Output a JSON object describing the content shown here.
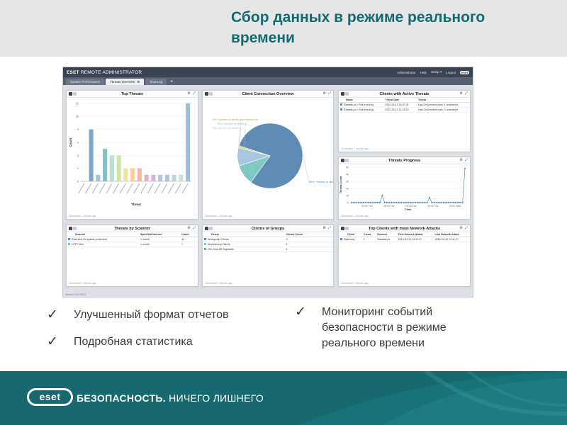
{
  "slide": {
    "title": "Сбор данных в режиме реального времени",
    "bullets_left": [
      "Улучшенный формат отчетов",
      "Подробная  статистика"
    ],
    "bullet_right": "Мониторинг событий безопасности в режиме реального времени",
    "check_glyph": "✓",
    "footer": {
      "logo_text": "eset",
      "slogan_bold": "БЕЗОПАСНОСТЬ.",
      "slogan_rest": " НИЧЕГО ЛИШНЕГО"
    },
    "colors": {
      "teal": "#15696f",
      "title": "#16696f",
      "band": "#e6e6e6"
    }
  },
  "era": {
    "brand_prefix": "ESET",
    "brand_suffix": " REMOTE ADMINISTRATOR",
    "top_links": [
      "Administrator",
      "Help",
      "Setup ▾",
      "Logout"
    ],
    "tabs": [
      {
        "label": "System Performance",
        "active": false
      },
      {
        "label": "Threats Overview",
        "active": true
      },
      {
        "label": "ScanLog",
        "active": false
      }
    ],
    "tab_add": "+",
    "version": "Version: 5.0.250.0"
  },
  "widgets": {
    "top_threats": {
      "title": "Top Threats",
      "footer": "Generated 1 minute ago",
      "chart_data": {
        "type": "bar",
        "xlabel": "Threat",
        "ylabel": "Count",
        "ylim": [
          0,
          12
        ],
        "yticks": [
          0,
          2,
          4,
          6,
          8,
          10,
          12
        ],
        "values": [
          0,
          8,
          1,
          5,
          4,
          4,
          2,
          2,
          2,
          1,
          1,
          1,
          1,
          1,
          1,
          12
        ],
        "colors": [
          "#5a8fb4",
          "#7fa6c6",
          "#9fc6dd",
          "#7cc3c2",
          "#b7e0cf",
          "#d0e3a6",
          "#ece59f",
          "#f6cf9b",
          "#f4b6a3",
          "#e9adc4",
          "#cfb7d9",
          "#b6c3e2",
          "#a9c6dc",
          "#b8d8dc",
          "#c9e4d6",
          "#9bbfd6"
        ]
      }
    },
    "client_connection": {
      "title": "Client Connection Overview",
      "footer": "Generated 1 minute ago",
      "chart_data": {
        "type": "pie",
        "slices": [
          {
            "label": "80% / Number of clien...",
            "value": 80,
            "color": "#5d8db5"
          },
          {
            "label": "10% / Number of clients di...",
            "value": 10,
            "color": "#7fc9c4"
          },
          {
            "label": "9% / Number of clients di...",
            "value": 9,
            "color": "#a9c6df"
          },
          {
            "label": "1% / Number of clients disconnected for...",
            "value": 1,
            "color": "#d8d27a"
          }
        ]
      }
    },
    "clients_active_threats": {
      "title": "Clients with Active Threats",
      "footer": "Generated 1 minute ago",
      "columns": [
        "Name",
        "Threat Date",
        "Threat"
      ],
      "rows": [
        [
          "Rakatak-pc / Rak-eea-eng",
          "2012-04-13 16:47:41",
          "Last OnDemand scan: 1 uncleaned"
        ],
        [
          "Rakatak-pc / Rak-eea-eng",
          "2012-04-13 11:18:29",
          "Last OnDemand scan: 2 uncleaned"
        ]
      ]
    },
    "threats_progress": {
      "title": "Threats Progress",
      "footer": "Generated 1 minute ago",
      "chart_data": {
        "type": "line",
        "xlabel": "Time",
        "ylabel": "Threats Count",
        "ylim": [
          0,
          50
        ],
        "yticks": [
          0,
          10,
          20,
          30,
          40,
          50
        ],
        "xtick_labels": [
          "00:00 Thu",
          "06:00 Tue",
          "00:00 Tue",
          "00:00 Tue",
          "00:00 Wed"
        ],
        "values": [
          0,
          0,
          0,
          0,
          0,
          0,
          0,
          0,
          0,
          0,
          0,
          0,
          0,
          10,
          0,
          0,
          0,
          0,
          0,
          0,
          0,
          0,
          0,
          0,
          0,
          0,
          0,
          0,
          0,
          0,
          0,
          0,
          0,
          7,
          0,
          0,
          0,
          0,
          0,
          0,
          0,
          0,
          0,
          0,
          0,
          0,
          0,
          0,
          48
        ]
      }
    },
    "threats_by_scanner": {
      "title": "Threats by Scanner",
      "footer": "Generated 1 minute ago",
      "columns": [
        "Scanner",
        "Specified Interval",
        "Count"
      ],
      "rows": [
        {
          "color": "#5d8db5",
          "cells": [
            "Real-time file system protection",
            "1 month",
            "41"
          ]
        },
        {
          "color": "#7fc9c4",
          "cells": [
            "HTTP filter",
            "1 month",
            "7"
          ]
        }
      ]
    },
    "clients_of_groups": {
      "title": "Clients of Groups",
      "footer": "Generated 1 minute ago",
      "columns": [
        "Group",
        "Clients Count"
      ],
      "rows": [
        {
          "color": "#5d8db5",
          "cells": [
            "Workgroup Clients",
            "3"
          ]
        },
        {
          "color": "#7fc9c4",
          "cells": [
            "AnyWarning Clients",
            "1"
          ]
        },
        {
          "color": "#6bb36b",
          "cells": [
            "Old Virus DB Signature",
            "1"
          ]
        }
      ]
    },
    "top_clients_attacks": {
      "title": "Top Clients with most Network Attacks",
      "footer": "Generated 1 minute ago",
      "columns": [
        "Client",
        "Count",
        "Scanner",
        "First Network Attack",
        "Last Network Attack"
      ],
      "rows": [
        [
          "Rakovsky",
          "1",
          "Rakatak-pc",
          "2012-04-10 13:11:27",
          "2012-04-10 13:11:27"
        ]
      ]
    }
  }
}
